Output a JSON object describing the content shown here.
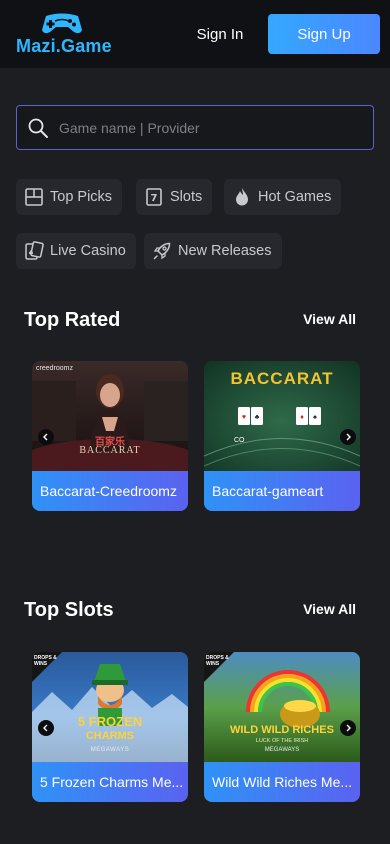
{
  "header": {
    "logo_text": "Mazi.Game",
    "signin_label": "Sign In",
    "signup_label": "Sign Up"
  },
  "search": {
    "placeholder": "Game name | Provider"
  },
  "categories": [
    {
      "label": "Top Picks",
      "icon": "grid-icon"
    },
    {
      "label": "Slots",
      "icon": "slot-machine-icon"
    },
    {
      "label": "Hot Games",
      "icon": "flame-icon"
    },
    {
      "label": "Live Casino",
      "icon": "cards-icon"
    },
    {
      "label": "New Releases",
      "icon": "rocket-icon"
    }
  ],
  "sections": [
    {
      "title": "Top Rated",
      "view_all": "View All",
      "games": [
        {
          "name": "Baccarat-Creedroomz",
          "thumb_brand": "creedroomz",
          "thumb_title": "BACCARAT",
          "thumb_sub": "百家乐"
        },
        {
          "name": "Baccarat-gameart",
          "thumb_title": "BACCARAT",
          "thumb_sub": "CO"
        }
      ]
    },
    {
      "title": "Top Slots",
      "view_all": "View All",
      "games": [
        {
          "name": "5 Frozen Charms Me...",
          "badge": "DROPS & WINS",
          "thumb_title_a": "5 FROZEN",
          "thumb_title_b": "CHARMS",
          "thumb_sub": "MEGAWAYS"
        },
        {
          "name": "Wild Wild Riches Me...",
          "badge": "DROPS & WINS",
          "thumb_title_a": "WILD WILD RICHES",
          "thumb_sub": "LUCK OF THE IRISH",
          "thumb_sub2": "MEGAWAYS"
        }
      ]
    }
  ],
  "colors": {
    "accent": "#34a8ff",
    "accent2": "#5a62f0",
    "background": "#1d1e22",
    "header": "#101114"
  }
}
